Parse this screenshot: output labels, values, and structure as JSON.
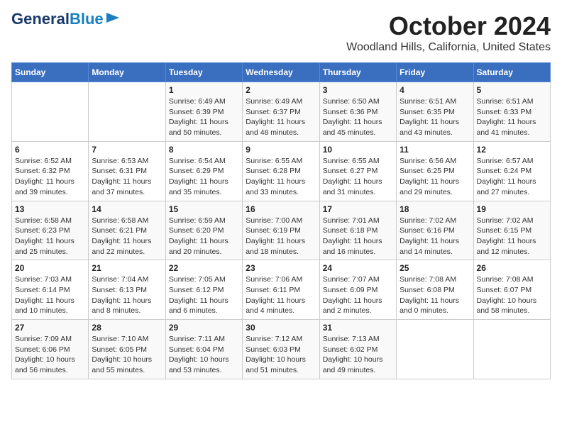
{
  "logo": {
    "line1": "General",
    "line2": "Blue"
  },
  "title": "October 2024",
  "subtitle": "Woodland Hills, California, United States",
  "headers": [
    "Sunday",
    "Monday",
    "Tuesday",
    "Wednesday",
    "Thursday",
    "Friday",
    "Saturday"
  ],
  "weeks": [
    [
      {
        "num": "",
        "info": ""
      },
      {
        "num": "",
        "info": ""
      },
      {
        "num": "1",
        "info": "Sunrise: 6:49 AM\nSunset: 6:39 PM\nDaylight: 11 hours and 50 minutes."
      },
      {
        "num": "2",
        "info": "Sunrise: 6:49 AM\nSunset: 6:37 PM\nDaylight: 11 hours and 48 minutes."
      },
      {
        "num": "3",
        "info": "Sunrise: 6:50 AM\nSunset: 6:36 PM\nDaylight: 11 hours and 45 minutes."
      },
      {
        "num": "4",
        "info": "Sunrise: 6:51 AM\nSunset: 6:35 PM\nDaylight: 11 hours and 43 minutes."
      },
      {
        "num": "5",
        "info": "Sunrise: 6:51 AM\nSunset: 6:33 PM\nDaylight: 11 hours and 41 minutes."
      }
    ],
    [
      {
        "num": "6",
        "info": "Sunrise: 6:52 AM\nSunset: 6:32 PM\nDaylight: 11 hours and 39 minutes."
      },
      {
        "num": "7",
        "info": "Sunrise: 6:53 AM\nSunset: 6:31 PM\nDaylight: 11 hours and 37 minutes."
      },
      {
        "num": "8",
        "info": "Sunrise: 6:54 AM\nSunset: 6:29 PM\nDaylight: 11 hours and 35 minutes."
      },
      {
        "num": "9",
        "info": "Sunrise: 6:55 AM\nSunset: 6:28 PM\nDaylight: 11 hours and 33 minutes."
      },
      {
        "num": "10",
        "info": "Sunrise: 6:55 AM\nSunset: 6:27 PM\nDaylight: 11 hours and 31 minutes."
      },
      {
        "num": "11",
        "info": "Sunrise: 6:56 AM\nSunset: 6:25 PM\nDaylight: 11 hours and 29 minutes."
      },
      {
        "num": "12",
        "info": "Sunrise: 6:57 AM\nSunset: 6:24 PM\nDaylight: 11 hours and 27 minutes."
      }
    ],
    [
      {
        "num": "13",
        "info": "Sunrise: 6:58 AM\nSunset: 6:23 PM\nDaylight: 11 hours and 25 minutes."
      },
      {
        "num": "14",
        "info": "Sunrise: 6:58 AM\nSunset: 6:21 PM\nDaylight: 11 hours and 22 minutes."
      },
      {
        "num": "15",
        "info": "Sunrise: 6:59 AM\nSunset: 6:20 PM\nDaylight: 11 hours and 20 minutes."
      },
      {
        "num": "16",
        "info": "Sunrise: 7:00 AM\nSunset: 6:19 PM\nDaylight: 11 hours and 18 minutes."
      },
      {
        "num": "17",
        "info": "Sunrise: 7:01 AM\nSunset: 6:18 PM\nDaylight: 11 hours and 16 minutes."
      },
      {
        "num": "18",
        "info": "Sunrise: 7:02 AM\nSunset: 6:16 PM\nDaylight: 11 hours and 14 minutes."
      },
      {
        "num": "19",
        "info": "Sunrise: 7:02 AM\nSunset: 6:15 PM\nDaylight: 11 hours and 12 minutes."
      }
    ],
    [
      {
        "num": "20",
        "info": "Sunrise: 7:03 AM\nSunset: 6:14 PM\nDaylight: 11 hours and 10 minutes."
      },
      {
        "num": "21",
        "info": "Sunrise: 7:04 AM\nSunset: 6:13 PM\nDaylight: 11 hours and 8 minutes."
      },
      {
        "num": "22",
        "info": "Sunrise: 7:05 AM\nSunset: 6:12 PM\nDaylight: 11 hours and 6 minutes."
      },
      {
        "num": "23",
        "info": "Sunrise: 7:06 AM\nSunset: 6:11 PM\nDaylight: 11 hours and 4 minutes."
      },
      {
        "num": "24",
        "info": "Sunrise: 7:07 AM\nSunset: 6:09 PM\nDaylight: 11 hours and 2 minutes."
      },
      {
        "num": "25",
        "info": "Sunrise: 7:08 AM\nSunset: 6:08 PM\nDaylight: 11 hours and 0 minutes."
      },
      {
        "num": "26",
        "info": "Sunrise: 7:08 AM\nSunset: 6:07 PM\nDaylight: 10 hours and 58 minutes."
      }
    ],
    [
      {
        "num": "27",
        "info": "Sunrise: 7:09 AM\nSunset: 6:06 PM\nDaylight: 10 hours and 56 minutes."
      },
      {
        "num": "28",
        "info": "Sunrise: 7:10 AM\nSunset: 6:05 PM\nDaylight: 10 hours and 55 minutes."
      },
      {
        "num": "29",
        "info": "Sunrise: 7:11 AM\nSunset: 6:04 PM\nDaylight: 10 hours and 53 minutes."
      },
      {
        "num": "30",
        "info": "Sunrise: 7:12 AM\nSunset: 6:03 PM\nDaylight: 10 hours and 51 minutes."
      },
      {
        "num": "31",
        "info": "Sunrise: 7:13 AM\nSunset: 6:02 PM\nDaylight: 10 hours and 49 minutes."
      },
      {
        "num": "",
        "info": ""
      },
      {
        "num": "",
        "info": ""
      }
    ]
  ]
}
